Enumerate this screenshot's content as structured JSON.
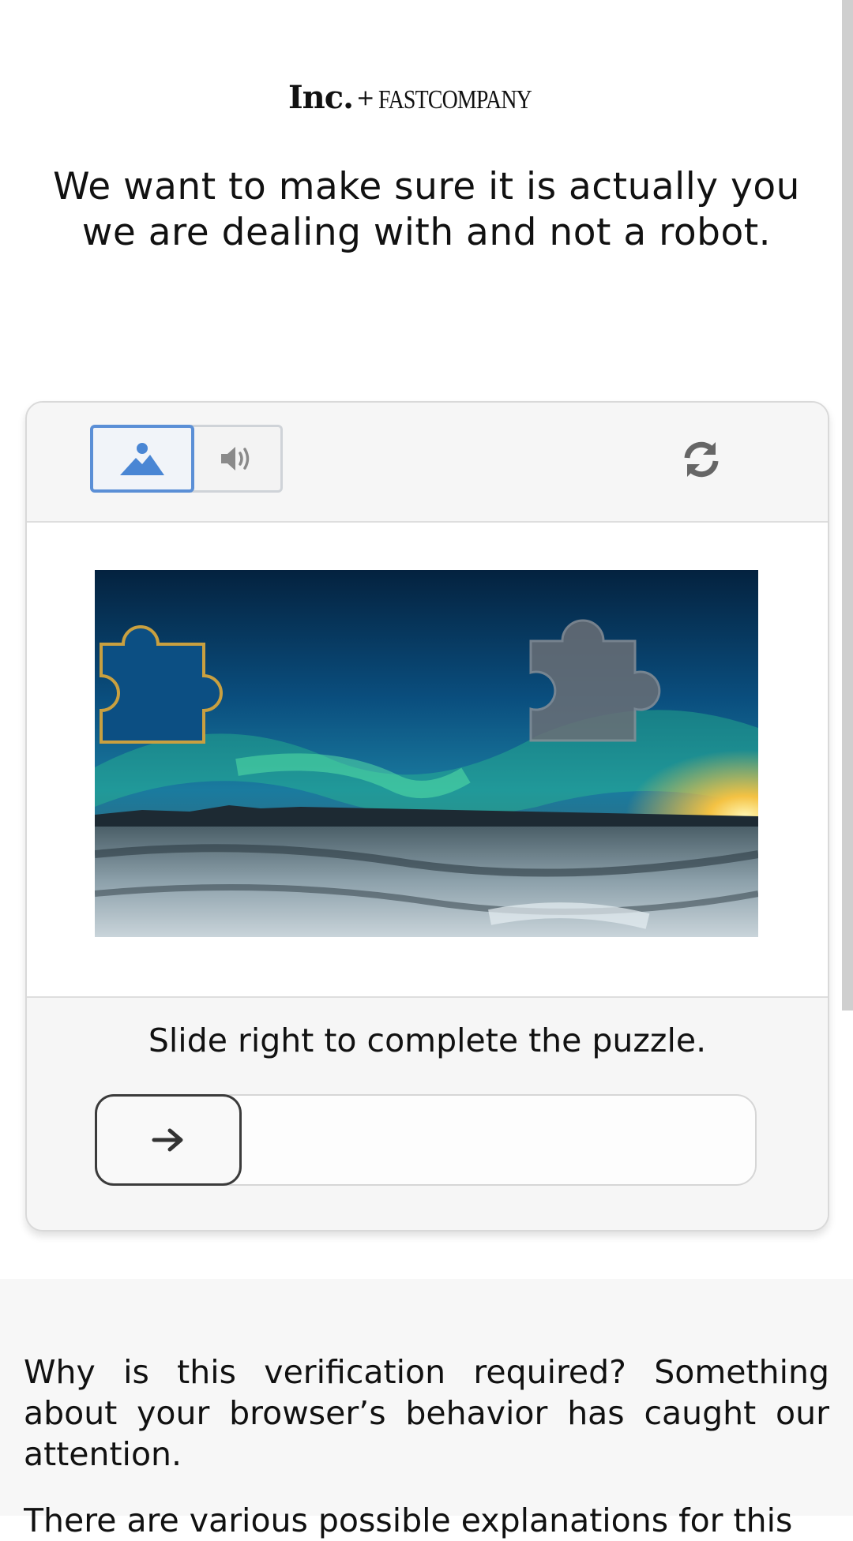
{
  "logo": {
    "inc": "Inc.",
    "plus": "+",
    "fastcompany": "FASTCOMPANY"
  },
  "headline": "We want to make sure it is actually you we are dealing with and not a robot.",
  "captcha": {
    "modes": [
      {
        "name": "image-mode",
        "icon": "image-icon",
        "selected": true
      },
      {
        "name": "audio-mode",
        "icon": "speaker-icon",
        "selected": false
      }
    ],
    "refresh_icon": "refresh-icon",
    "instruction": "Slide right to complete the puzzle.",
    "slider_icon": "arrow-right-icon",
    "slider_progress": 0
  },
  "footer": {
    "why": "Why is this verification required? Something about your browser’s behavior has caught our attention.",
    "more": "There are various possible explanations for this"
  },
  "colors": {
    "accent": "#5b8fd6",
    "piece_outline": "#c9a040"
  }
}
